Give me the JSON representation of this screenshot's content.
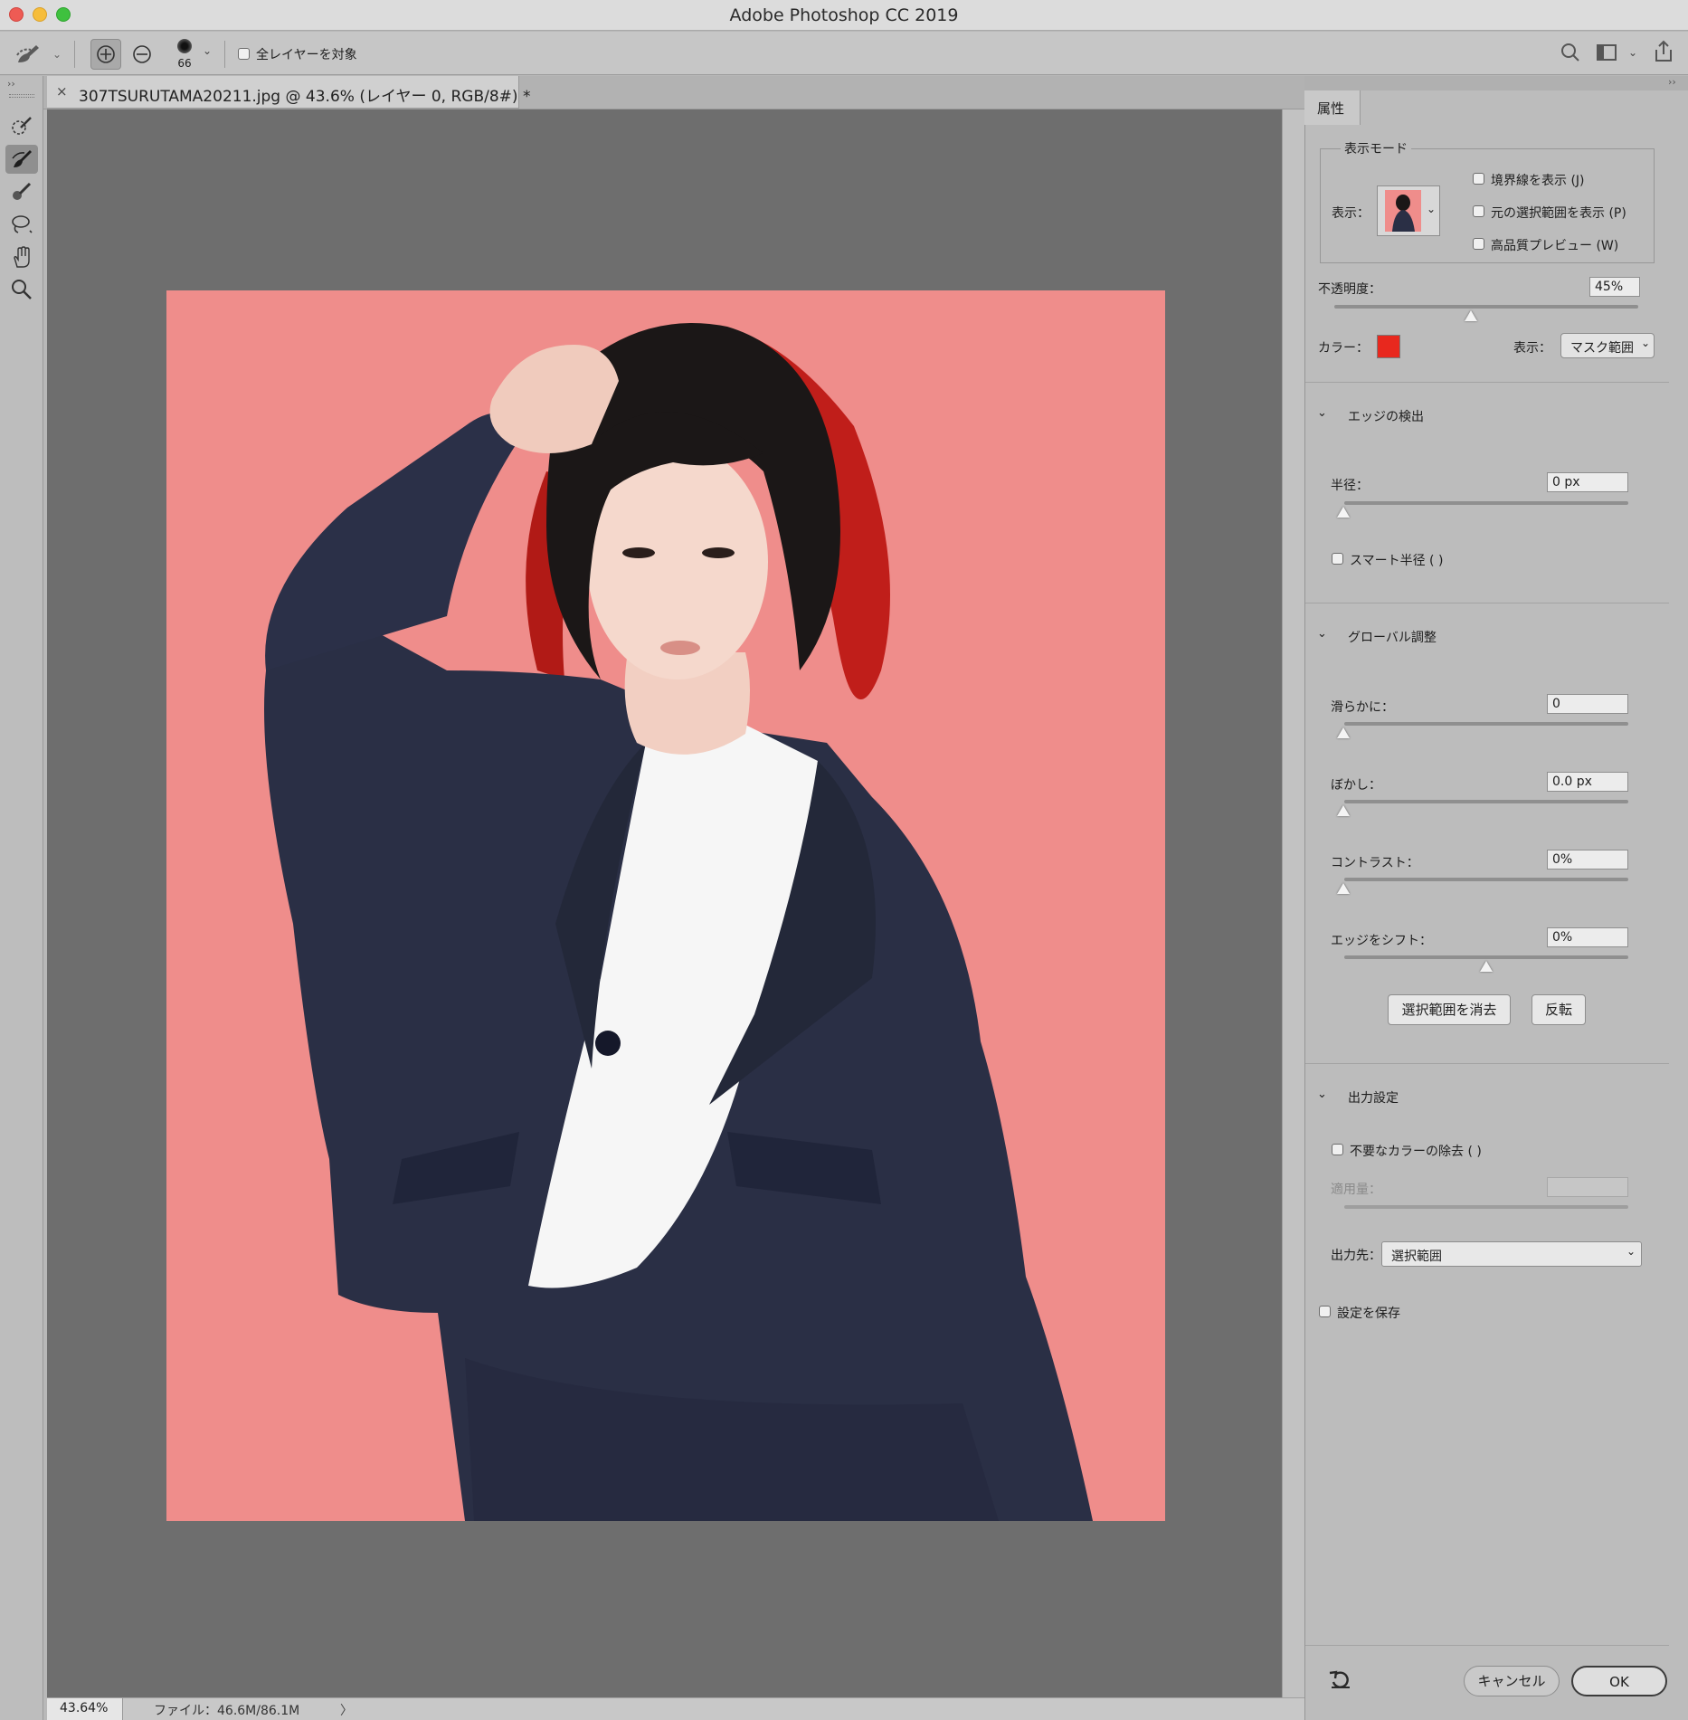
{
  "window": {
    "title": "Adobe Photoshop CC 2019"
  },
  "options_bar": {
    "brush_size": "66",
    "sample_all_layers_label": "全レイヤーを対象"
  },
  "document": {
    "tab_title": "307TSURUTAMA20211.jpg @ 43.6% (レイヤー 0, RGB/8#) *",
    "close_glyph": "×"
  },
  "status_bar": {
    "zoom": "43.64%",
    "file_info": "ファイル：46.6M/86.1M",
    "arrow": "〉"
  },
  "properties_panel": {
    "tab_label": "属性",
    "view_mode": {
      "group_label": "表示モード",
      "view_label": "表示：",
      "show_edge": "境界線を表示 (J)",
      "show_original": "元の選択範囲を表示 (P)",
      "hq_preview": "高品質プレビュー (W)"
    },
    "opacity": {
      "label": "不透明度：",
      "value": "45%",
      "fraction": 0.45
    },
    "color": {
      "label": "カラー：",
      "swatch": "#e8281e"
    },
    "display": {
      "label": "表示：",
      "value": "マスク範囲"
    },
    "edge_detection": {
      "header": "エッジの検出",
      "radius_label": "半径：",
      "radius_value": "0 px",
      "smart_radius": "スマート半径 (  )"
    },
    "global_refinements": {
      "header": "グローバル調整",
      "smooth_label": "滑らかに：",
      "smooth_value": "0",
      "feather_label": "ぼかし：",
      "feather_value": "0.0 px",
      "contrast_label": "コントラスト：",
      "contrast_value": "0%",
      "shift_edge_label": "エッジをシフト：",
      "shift_edge_value": "0%",
      "clear_selection": "選択範囲を消去",
      "invert": "反転"
    },
    "output": {
      "header": "出力設定",
      "decontaminate": "不要なカラーの除去 (  )",
      "amount_label": "適用量：",
      "output_to_label": "出力先：",
      "output_to_value": "選択範囲",
      "remember": "設定を保存"
    },
    "cancel": "キャンセル",
    "ok": "OK"
  },
  "colors": {
    "canvas_bg": "#6e6e6e",
    "overlay": "#ef8d8b",
    "suit": "#2a2f45",
    "hair": "#1b1717"
  }
}
